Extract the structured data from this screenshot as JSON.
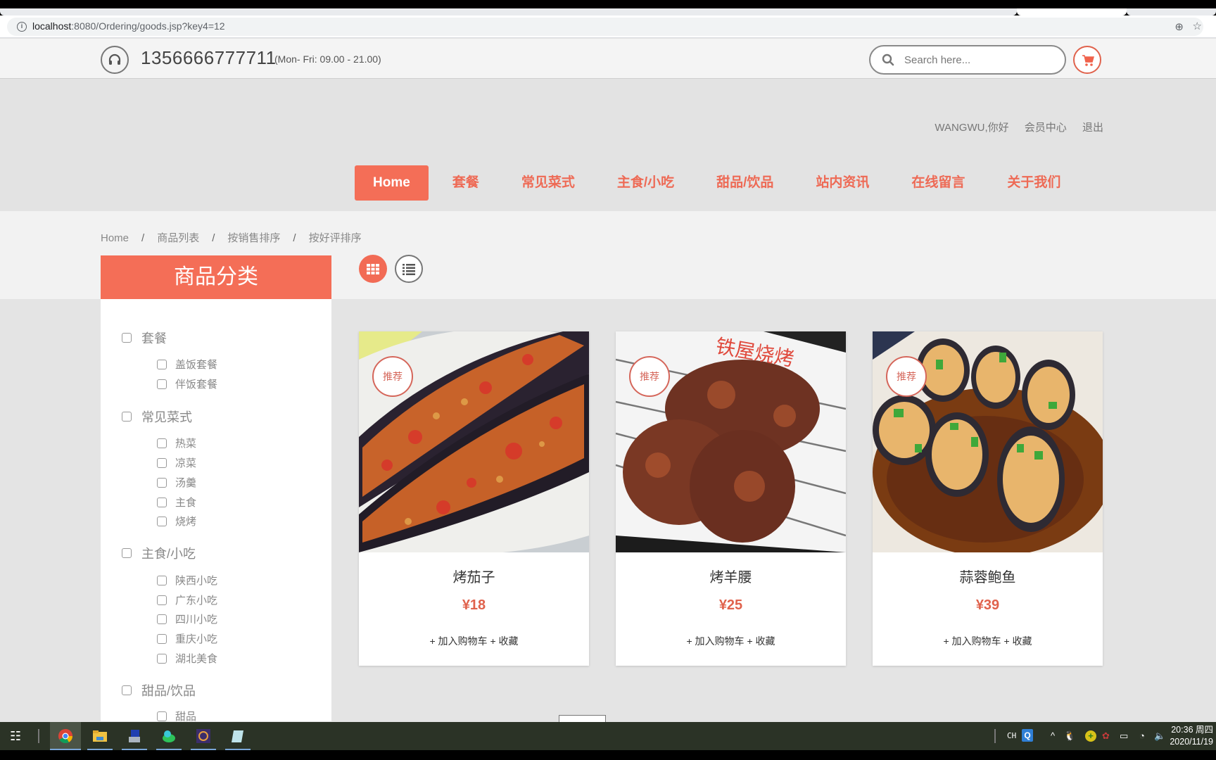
{
  "browser": {
    "url_host": "localhost",
    "url_rest": ":8080/Ordering/goods.jsp?key4=12"
  },
  "topbar": {
    "phone": "1356666777711",
    "hours": "(Mon- Fri: 09.00 - 21.00)",
    "search_placeholder": "Search here...",
    "icons": {
      "phone": "headset-icon",
      "search": "search-icon",
      "cart": "cart-icon"
    }
  },
  "header": {
    "user_greeting": "WANGWU,你好",
    "member_center": "会员中心",
    "logout": "退出",
    "nav": [
      {
        "label": "Home",
        "active": true
      },
      {
        "label": "套餐"
      },
      {
        "label": "常见菜式"
      },
      {
        "label": "主食/小吃"
      },
      {
        "label": "甜品/饮品"
      },
      {
        "label": "站内资讯"
      },
      {
        "label": "在线留言"
      },
      {
        "label": "关于我们"
      }
    ]
  },
  "breadcrumb": [
    "Home",
    "商品列表",
    "按销售排序",
    "按好评排序"
  ],
  "view_toggle": {
    "grid": "grid-view-icon",
    "list": "list-view-icon",
    "active": "grid"
  },
  "sidebar": {
    "title": "商品分类",
    "categories": [
      {
        "label": "套餐",
        "children": [
          "盖饭套餐",
          "伴饭套餐"
        ]
      },
      {
        "label": "常见菜式",
        "children": [
          "热菜",
          "凉菜",
          "汤羹",
          "主食",
          "烧烤"
        ]
      },
      {
        "label": "主食/小吃",
        "children": [
          "陕西小吃",
          "广东小吃",
          "四川小吃",
          "重庆小吃",
          "湖北美食"
        ]
      },
      {
        "label": "甜品/饮品",
        "children": [
          "甜品"
        ]
      }
    ]
  },
  "products": [
    {
      "badge": "推荐",
      "name": "烤茄子",
      "price": "¥18",
      "actions": "+ 加入购物车 + 收藏"
    },
    {
      "badge": "推荐",
      "name": "烤羊腰",
      "price": "¥25",
      "actions": "+ 加入购物车 + 收藏"
    },
    {
      "badge": "推荐",
      "name": "蒜蓉鲍鱼",
      "price": "¥39",
      "actions": "+ 加入购物车 + 收藏"
    }
  ],
  "colors": {
    "accent": "#f46e57",
    "price": "#e0624c",
    "badge": "#d5665a"
  },
  "taskbar": {
    "apps": [
      "chrome",
      "file-explorer",
      "remote-desktop",
      "app-green",
      "java-ee-ide",
      "notepad"
    ],
    "ime": "CH",
    "time": "20:36 周四",
    "date": "2020/11/19"
  }
}
